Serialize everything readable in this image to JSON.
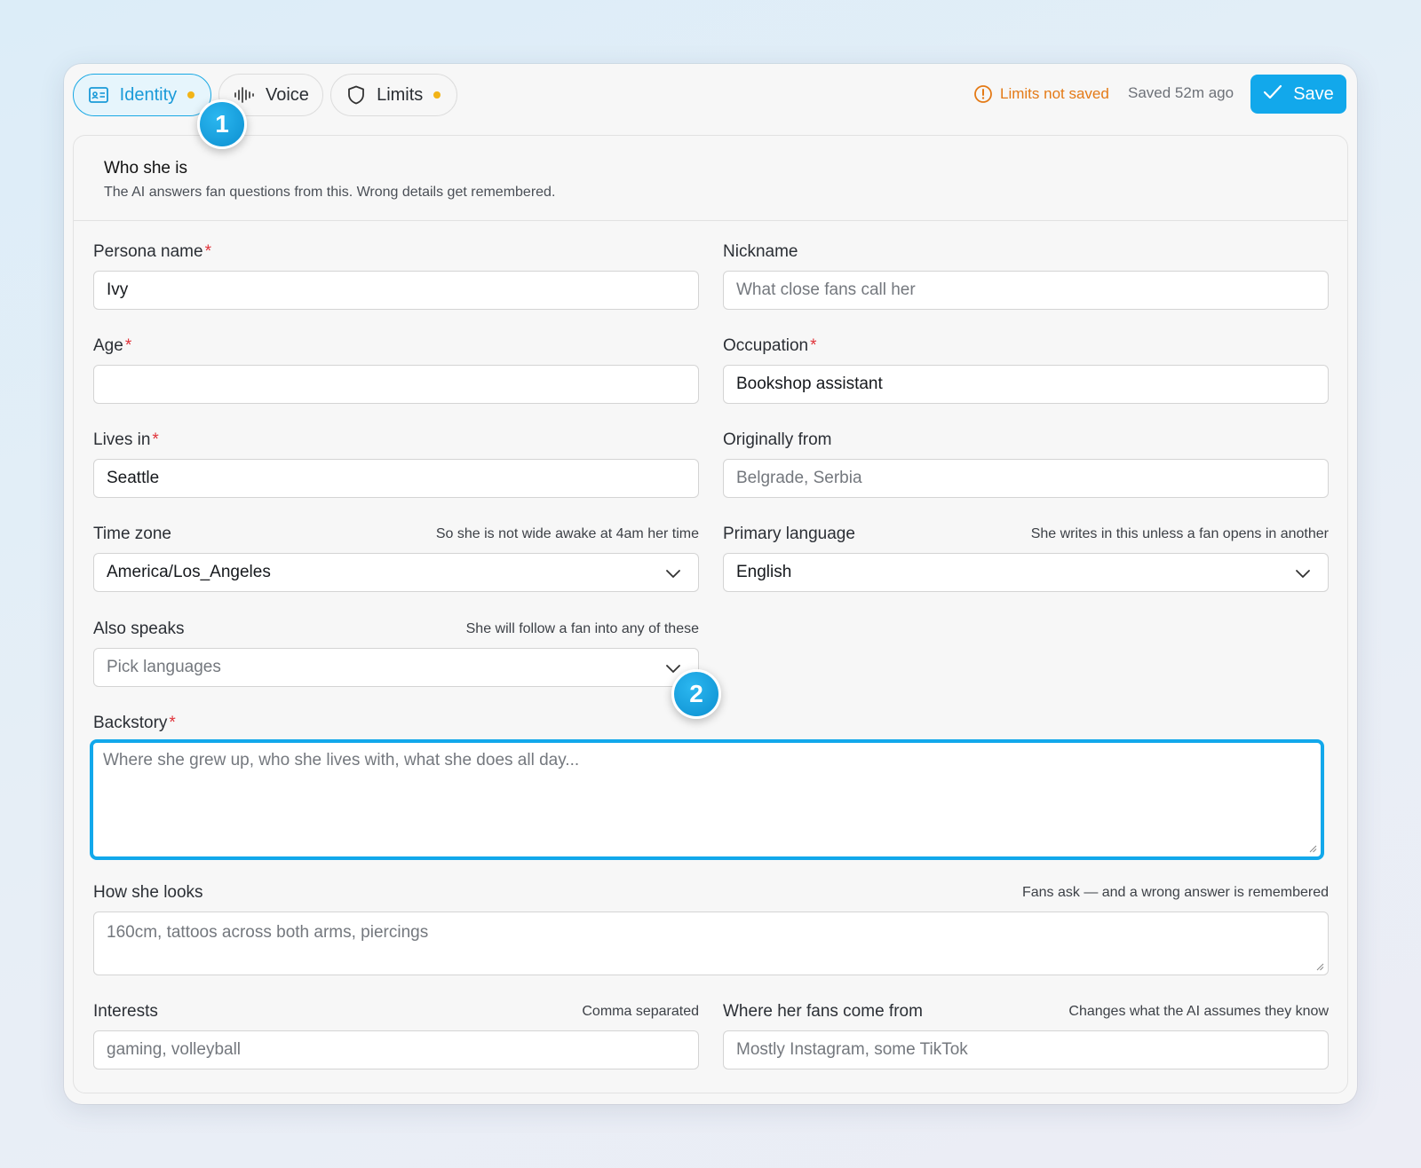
{
  "tabs": [
    {
      "label": "Identity",
      "icon": "id-card-icon",
      "active": true,
      "unsaved_dot": true
    },
    {
      "label": "Voice",
      "icon": "waveform-icon",
      "active": false,
      "unsaved_dot": false
    },
    {
      "label": "Limits",
      "icon": "shield-icon",
      "active": false,
      "unsaved_dot": true
    }
  ],
  "status": {
    "warning": "Limits not saved",
    "saved": "Saved 52m ago"
  },
  "save_label": "Save",
  "badges": [
    "1",
    "2"
  ],
  "section": {
    "title": "Who she is",
    "subtitle": "The AI answers fan questions from this. Wrong details get remembered."
  },
  "fields": {
    "persona_name": {
      "label": "Persona name",
      "required": true,
      "value": "Ivy"
    },
    "nickname": {
      "label": "Nickname",
      "placeholder": "What close fans call her"
    },
    "age": {
      "label": "Age",
      "required": true,
      "value": ""
    },
    "occupation": {
      "label": "Occupation",
      "required": true,
      "value": "Bookshop assistant"
    },
    "lives_in": {
      "label": "Lives in",
      "required": true,
      "value": "Seattle"
    },
    "originally_from": {
      "label": "Originally from",
      "placeholder": "Belgrade, Serbia"
    },
    "time_zone": {
      "label": "Time zone",
      "hint": "So she is not wide awake at 4am her time",
      "value": "America/Los_Angeles"
    },
    "primary_language": {
      "label": "Primary language",
      "hint": "She writes in this unless a fan opens in another",
      "value": "English"
    },
    "also_speaks": {
      "label": "Also speaks",
      "hint": "She will follow a fan into any of these",
      "placeholder": "Pick languages"
    },
    "backstory": {
      "label": "Backstory",
      "required": true,
      "placeholder": "Where she grew up, who she lives with, what she does all day..."
    },
    "looks": {
      "label": "How she looks",
      "hint": "Fans ask — and a wrong answer is remembered",
      "placeholder": "160cm, tattoos across both arms, piercings"
    },
    "interests": {
      "label": "Interests",
      "hint": "Comma separated",
      "placeholder": "gaming, volleyball"
    },
    "fans_from": {
      "label": "Where her fans come from",
      "hint": "Changes what the AI assumes they know",
      "placeholder": "Mostly Instagram, some TikTok"
    }
  },
  "colors": {
    "accent": "#12a8eb",
    "warning": "#e47a16",
    "dot": "#f2b417",
    "required": "#e0333a"
  }
}
